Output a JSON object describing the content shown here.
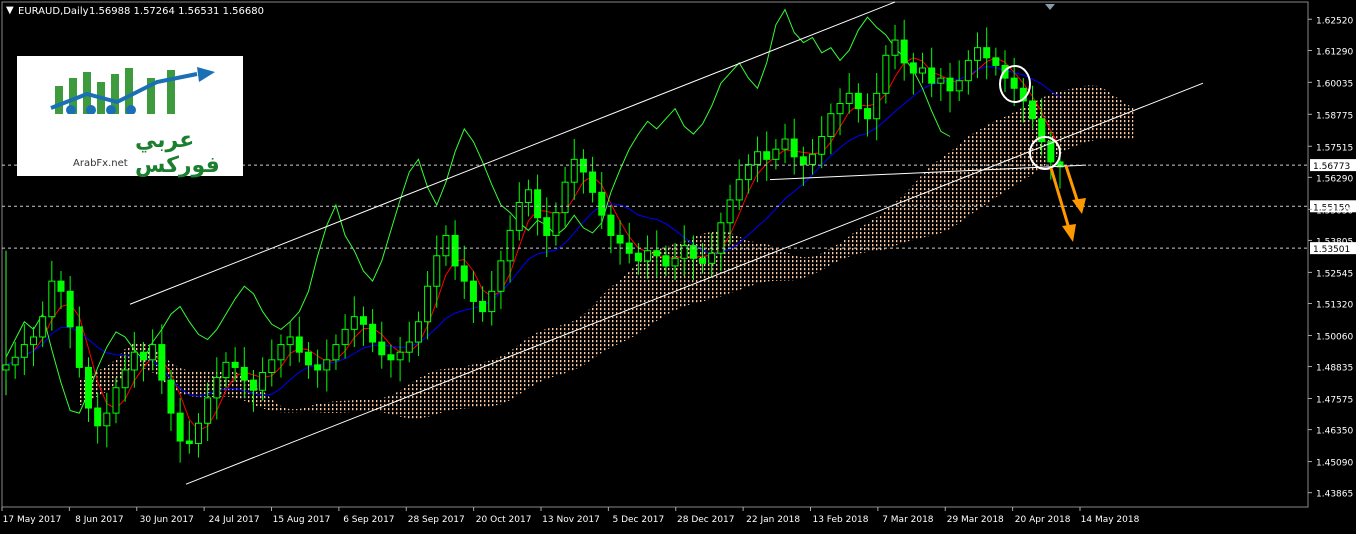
{
  "header": {
    "symbol_label": "EURAUD,Daily",
    "ohlc_label": "1.56988 1.57264 1.56531 1.56680"
  },
  "logo": {
    "arabic_text": "عربي فوركس",
    "site": "ArabFx.net"
  },
  "colors": {
    "background": "#000000",
    "candles": "#00ff00",
    "lagging_span": "#33ff33",
    "tenkan": "#ff0000",
    "kijun": "#0000ff",
    "cloud": "#ffc8a0",
    "channel": "#ffffff",
    "arrows": "#ff9900"
  },
  "chart_data": {
    "type": "candlestick",
    "instrument": "EURAUD",
    "timeframe": "Daily",
    "ylim": [
      1.433,
      1.632
    ],
    "y_ticks": [
      "1.62520",
      "1.61290",
      "1.60035",
      "1.58775",
      "1.57515",
      "1.56290",
      "1.55030",
      "1.53805",
      "1.52545",
      "1.51320",
      "1.50060",
      "1.48835",
      "1.47575",
      "1.46350",
      "1.45090",
      "1.43865"
    ],
    "x_labels": [
      "17 May 2017",
      "8 Jun 2017",
      "30 Jun 2017",
      "24 Jul 2017",
      "15 Aug 2017",
      "6 Sep 2017",
      "28 Sep 2017",
      "20 Oct 2017",
      "13 Nov 2017",
      "5 Dec 2017",
      "28 Dec 2017",
      "22 Jan 2018",
      "13 Feb 2018",
      "7 Mar 2018",
      "29 Mar 2018",
      "20 Apr 2018",
      "14 May 2018"
    ],
    "price_marks": [
      {
        "label": "1.56773",
        "value": 1.56773,
        "style": "current"
      },
      {
        "label": "1.55150",
        "value": 1.5515,
        "style": "level"
      },
      {
        "label": "1.53501",
        "value": 1.53501,
        "style": "level"
      }
    ],
    "close_series": [
      1.489,
      1.492,
      1.497,
      1.5,
      1.508,
      1.522,
      1.518,
      1.504,
      1.488,
      1.472,
      1.465,
      1.47,
      1.48,
      1.487,
      1.494,
      1.491,
      1.497,
      1.483,
      1.47,
      1.459,
      1.458,
      1.466,
      1.476,
      1.484,
      1.49,
      1.488,
      1.483,
      1.479,
      1.486,
      1.491,
      1.497,
      1.5,
      1.494,
      1.489,
      1.487,
      1.491,
      1.497,
      1.503,
      1.508,
      1.505,
      1.498,
      1.493,
      1.491,
      1.494,
      1.498,
      1.506,
      1.52,
      1.532,
      1.54,
      1.528,
      1.522,
      1.514,
      1.51,
      1.518,
      1.53,
      1.542,
      1.553,
      1.558,
      1.547,
      1.54,
      1.549,
      1.561,
      1.57,
      1.565,
      1.557,
      1.548,
      1.54,
      1.537,
      1.533,
      1.53,
      1.534,
      1.532,
      1.528,
      1.531,
      1.536,
      1.531,
      1.529,
      1.533,
      1.545,
      1.554,
      1.562,
      1.568,
      1.573,
      1.57,
      1.574,
      1.578,
      1.571,
      1.568,
      1.572,
      1.579,
      1.588,
      1.592,
      1.596,
      1.59,
      1.586,
      1.596,
      1.611,
      1.617,
      1.608,
      1.604,
      1.606,
      1.6,
      1.602,
      1.597,
      1.601,
      1.609,
      1.614,
      1.61,
      1.607,
      1.602,
      1.598,
      1.593,
      1.586,
      1.577,
      1.569,
      1.567
    ],
    "channel_lines": [
      {
        "name": "upper",
        "from": [
          0.0,
          1.5129
        ],
        "to": [
          1.0,
          1.632
        ]
      },
      {
        "name": "lower",
        "from": [
          0.0,
          1.442
        ],
        "to": [
          1.0,
          1.605
        ]
      }
    ],
    "markers": [
      "circle at 20 Apr 2018 high",
      "circle at channel break",
      "two orange down arrows toward 1.55150 and 1.53501"
    ],
    "grid": false
  }
}
